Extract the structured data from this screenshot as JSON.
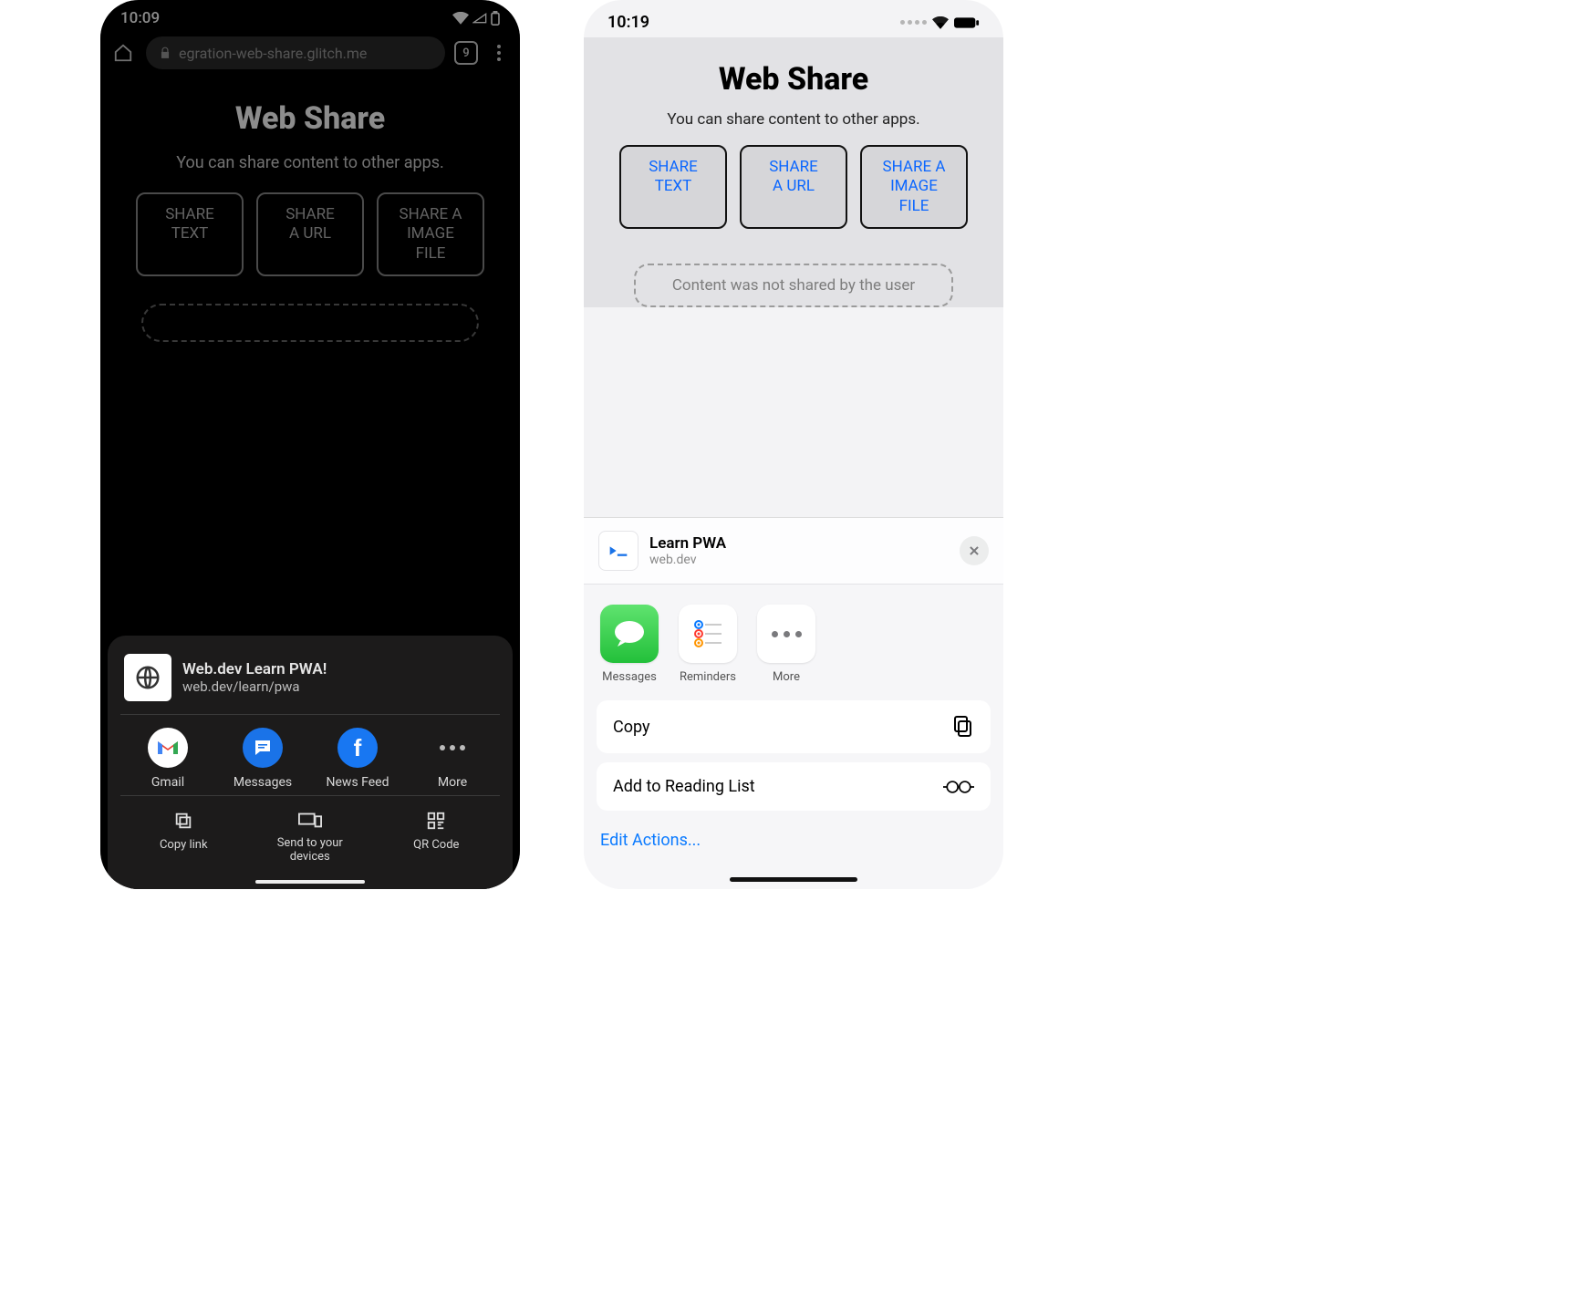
{
  "android": {
    "status": {
      "time": "10:09",
      "tabs_count": "9"
    },
    "urlbar": {
      "text": "egration-web-share.glitch.me"
    },
    "page": {
      "title": "Web Share",
      "subtitle": "You can share content to other apps.",
      "btn1_l1": "SHARE",
      "btn1_l2": "TEXT",
      "btn2_l1": "SHARE",
      "btn2_l2": "A URL",
      "btn3_l1": "SHARE A",
      "btn3_l2": "IMAGE",
      "btn3_l3": "FILE"
    },
    "sheet": {
      "title": "Web.dev Learn PWA!",
      "url": "web.dev/learn/pwa",
      "app1": "Gmail",
      "app2": "Messages",
      "app3": "News Feed",
      "app4": "More",
      "action1": "Copy link",
      "action2": "Send to your\ndevices",
      "action3": "QR Code"
    }
  },
  "ios": {
    "status": {
      "time": "10:19"
    },
    "page": {
      "title": "Web Share",
      "subtitle": "You can share content to other apps.",
      "btn1_l1": "SHARE",
      "btn1_l2": "TEXT",
      "btn2_l1": "SHARE",
      "btn2_l2": "A URL",
      "btn3_l1": "SHARE A",
      "btn3_l2": "IMAGE",
      "btn3_l3": "FILE",
      "result": "Content was not shared by the user"
    },
    "sheet": {
      "title": "Learn PWA",
      "sub": "web.dev",
      "app1": "Messages",
      "app2": "Reminders",
      "app3": "More",
      "action1": "Copy",
      "action2": "Add to Reading List",
      "edit": "Edit Actions..."
    }
  }
}
